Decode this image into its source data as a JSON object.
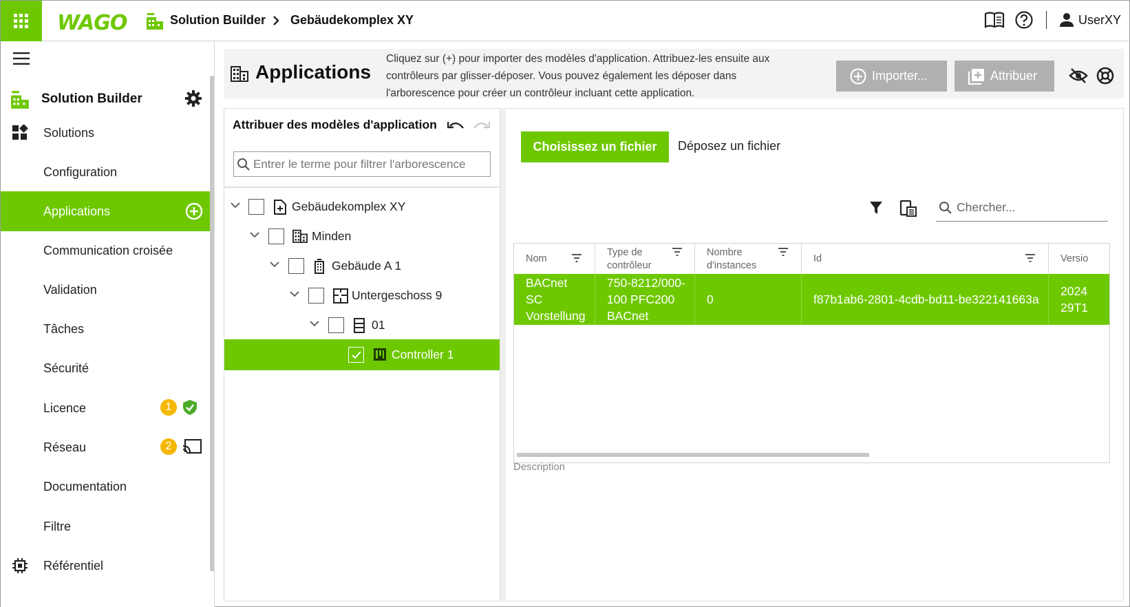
{
  "topbar": {
    "logo": "WAGO",
    "app_name": "Solution Builder",
    "project": "Gebäudekomplex XY",
    "user": "UserXY"
  },
  "sidebar": {
    "header_label": "Solution Builder",
    "items": [
      {
        "label": "Solutions",
        "icon": "dashboard-icon"
      },
      {
        "label": "Configuration"
      },
      {
        "label": "Applications",
        "active": true,
        "icon": "add-circle-icon"
      },
      {
        "label": "Communication croisée"
      },
      {
        "label": "Validation"
      },
      {
        "label": "Tâches"
      },
      {
        "label": "Sécurité"
      },
      {
        "label": "Licence",
        "badge": "1",
        "icon": "shield-check-icon"
      },
      {
        "label": "Réseau",
        "badge": "2",
        "icon": "cast-icon"
      },
      {
        "label": "Documentation"
      },
      {
        "label": "Filtre"
      },
      {
        "label": "Référentiel",
        "icon": "chip-icon"
      }
    ]
  },
  "page": {
    "title": "Applications",
    "description": "Cliquez sur (+) pour importer des modèles d'application. Attribuez-les ensuite aux contrôleurs par glisser-déposer. Vous pouvez également les déposer dans l'arborescence pour créer un contrôleur incluant cette application.",
    "import_label": "Importer...",
    "assign_label": "Attribuer"
  },
  "tree": {
    "title": "Attribuer des modèles d'application",
    "search_placeholder": "Entrer le terme pour filtrer l'arborescence",
    "nodes": [
      {
        "label": "Gebäudekomplex XY",
        "level": 0,
        "icon": "project-file-icon"
      },
      {
        "label": "Minden",
        "level": 1,
        "icon": "city-icon"
      },
      {
        "label": "Gebäude A 1",
        "level": 2,
        "icon": "building-icon"
      },
      {
        "label": "Untergeschoss 9",
        "level": 3,
        "icon": "floor-plan-icon"
      },
      {
        "label": "01",
        "level": 4,
        "icon": "room-icon"
      },
      {
        "label": "Controller 1",
        "level": 5,
        "icon": "controller-icon",
        "active": true,
        "checked": true
      }
    ]
  },
  "files": {
    "choose_label": "Choisissez un fichier",
    "drop_label": "Déposez un fichier",
    "search_placeholder": "Chercher..."
  },
  "grid": {
    "columns": [
      {
        "label": "Nom"
      },
      {
        "label_1": "Type de",
        "label_2": "contrôleur"
      },
      {
        "label_1": "Nombre",
        "label_2": "d'instances"
      },
      {
        "label": "Id"
      },
      {
        "label": "Versio"
      }
    ],
    "row": {
      "name_1": "BACnet",
      "name_2": "SC",
      "name_3": "Vorstellung",
      "type_1": "750-8212/000-",
      "type_2": "100 PFC200",
      "type_3": "BACnet",
      "instances": "0",
      "id": "f87b1ab6-2801-4cdb-bd11-be322141663a",
      "version_1": "2024",
      "version_2": "29T1"
    },
    "description_label": "Description"
  },
  "colors": {
    "accent": "#6ec800",
    "badge": "#f5b800",
    "button_gray": "#b0b0b0"
  }
}
